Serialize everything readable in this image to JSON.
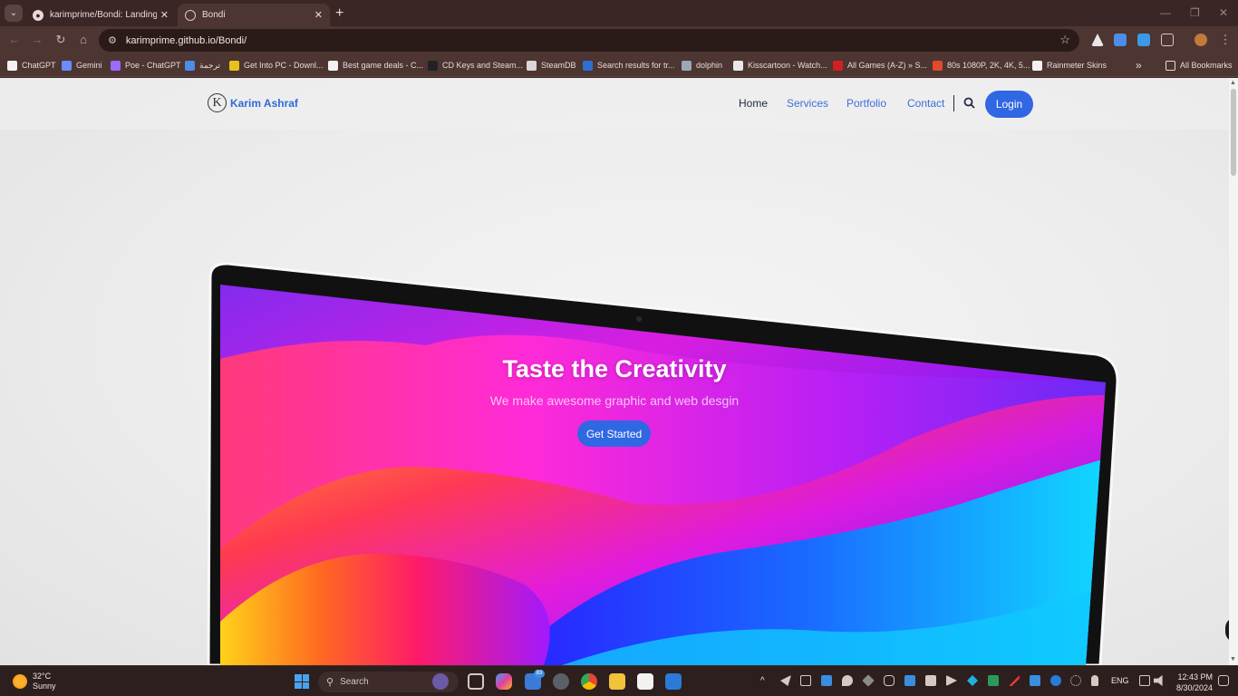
{
  "browser": {
    "tabs": [
      {
        "label": "karimprime/Bondi: Landing Pag",
        "close": "✕"
      },
      {
        "label": "Bondi",
        "close": "✕"
      }
    ],
    "new_tab": "+",
    "window_controls": [
      "—",
      "❐",
      "✕"
    ],
    "url": "karimprime.github.io/Bondi/",
    "bookmarks": [
      {
        "label": "ChatGPT",
        "color": "#f2f2f2"
      },
      {
        "label": "Gemini",
        "color": "#6b8cff"
      },
      {
        "label": "Poe - ChatGPT",
        "color": "#9b6bff"
      },
      {
        "label": "ترجمة",
        "color": "#4a8ee8"
      },
      {
        "label": "Get Into PC - Downl...",
        "color": "#e8c21a"
      },
      {
        "label": "Best game deals - C...",
        "color": "#f2f2f2"
      },
      {
        "label": "CD Keys and Steam...",
        "color": "#222222"
      },
      {
        "label": "SteamDB",
        "color": "#d8d8d8"
      },
      {
        "label": "Search results for tr...",
        "color": "#2e6fd1"
      },
      {
        "label": "dolphin",
        "color": "#9aa8b8"
      },
      {
        "label": "Kisscartoon - Watch...",
        "color": "#e8e8e8"
      },
      {
        "label": "All Games (A-Z) » S...",
        "color": "#d22020"
      },
      {
        "label": "80s 1080P, 2K, 4K, 5...",
        "color": "#e24a2a"
      },
      {
        "label": "Rainmeter Skins",
        "color": "#f2f2f2"
      }
    ],
    "bookmarks_more": "»",
    "all_bookmarks": "All Bookmarks"
  },
  "site": {
    "brand_initial": "K",
    "brand_name": "Karim Ashraf",
    "nav": [
      "Home",
      "Services",
      "Portfolio",
      "Contact"
    ],
    "login": "Login",
    "hero_title": "Taste the Creativity",
    "hero_subtitle": "We make awesome graphic and web desgin",
    "cta": "Get Started"
  },
  "taskbar": {
    "temp": "32°C",
    "condition": "Sunny",
    "search": "Search",
    "badge": "83",
    "lang": "ENG",
    "time": "12:43 PM",
    "date": "8/30/2024"
  },
  "colors": {
    "accent": "#3067e3",
    "brand_text": "#2f6ad9",
    "chrome_bg": "#3a2725"
  }
}
